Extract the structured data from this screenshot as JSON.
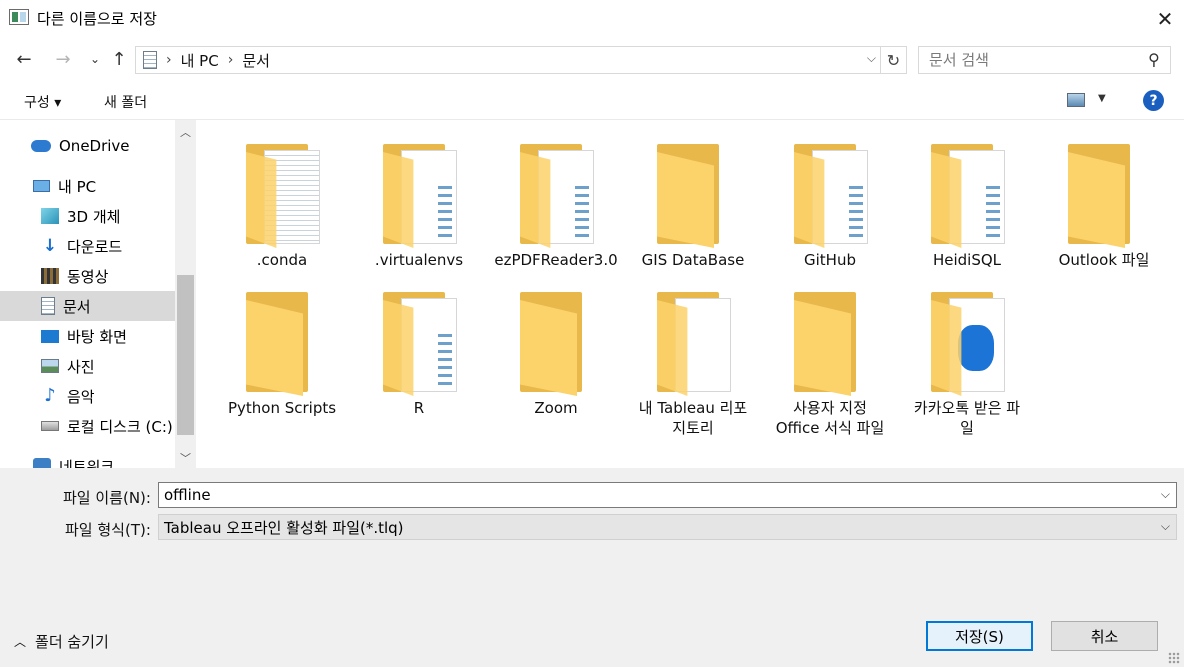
{
  "window": {
    "title": "다른 이름으로 저장"
  },
  "nav": {
    "breadcrumbs": [
      "내 PC",
      "문서"
    ],
    "search_placeholder": "문서 검색"
  },
  "toolbar": {
    "organize_label": "구성 ▾",
    "new_folder_label": "새 폴더",
    "help_label": "?"
  },
  "sidebar": {
    "items": [
      {
        "label": "OneDrive",
        "icon": "onedrive-cloud-icon"
      },
      {
        "label": "내 PC",
        "icon": "pc-icon"
      },
      {
        "label": "3D 개체",
        "icon": "3d-objects-icon"
      },
      {
        "label": "다운로드",
        "icon": "download-arrow-icon"
      },
      {
        "label": "동영상",
        "icon": "video-film-icon"
      },
      {
        "label": "문서",
        "icon": "document-icon",
        "selected": true
      },
      {
        "label": "바탕 화면",
        "icon": "desktop-icon"
      },
      {
        "label": "사진",
        "icon": "pictures-icon"
      },
      {
        "label": "음악",
        "icon": "music-note-icon"
      },
      {
        "label": "로컬 디스크 (C:)",
        "icon": "drive-icon"
      },
      {
        "label": "네트워크",
        "icon": "network-icon"
      }
    ]
  },
  "folders": [
    {
      "label": ".conda",
      "kind": "lines"
    },
    {
      "label": ".virtualenvs",
      "kind": "blue"
    },
    {
      "label": "ezPDFReader3.0",
      "kind": "blue"
    },
    {
      "label": "GIS DataBase",
      "kind": "plain"
    },
    {
      "label": "GitHub",
      "kind": "blue"
    },
    {
      "label": "HeidiSQL",
      "kind": "blue"
    },
    {
      "label": "Outlook 파일",
      "kind": "plain"
    },
    {
      "label": "Python Scripts",
      "kind": "plain"
    },
    {
      "label": "R",
      "kind": "blue"
    },
    {
      "label": "Zoom",
      "kind": "plain"
    },
    {
      "label": "내 Tableau 리포\n지토리",
      "kind": "paper"
    },
    {
      "label": "사용자 지정\nOffice 서식 파일",
      "kind": "plain"
    },
    {
      "label": "카카오톡 받은 파\n일",
      "kind": "kakao"
    }
  ],
  "form": {
    "filename_label": "파일 이름(N):",
    "filename_value": "offline",
    "filetype_label": "파일 형식(T):",
    "filetype_value": "Tableau 오프라인 활성화 파일(*.tlq)"
  },
  "footer": {
    "hide_folders_label": "폴더 숨기기",
    "save_label": "저장(S)",
    "cancel_label": "취소"
  }
}
